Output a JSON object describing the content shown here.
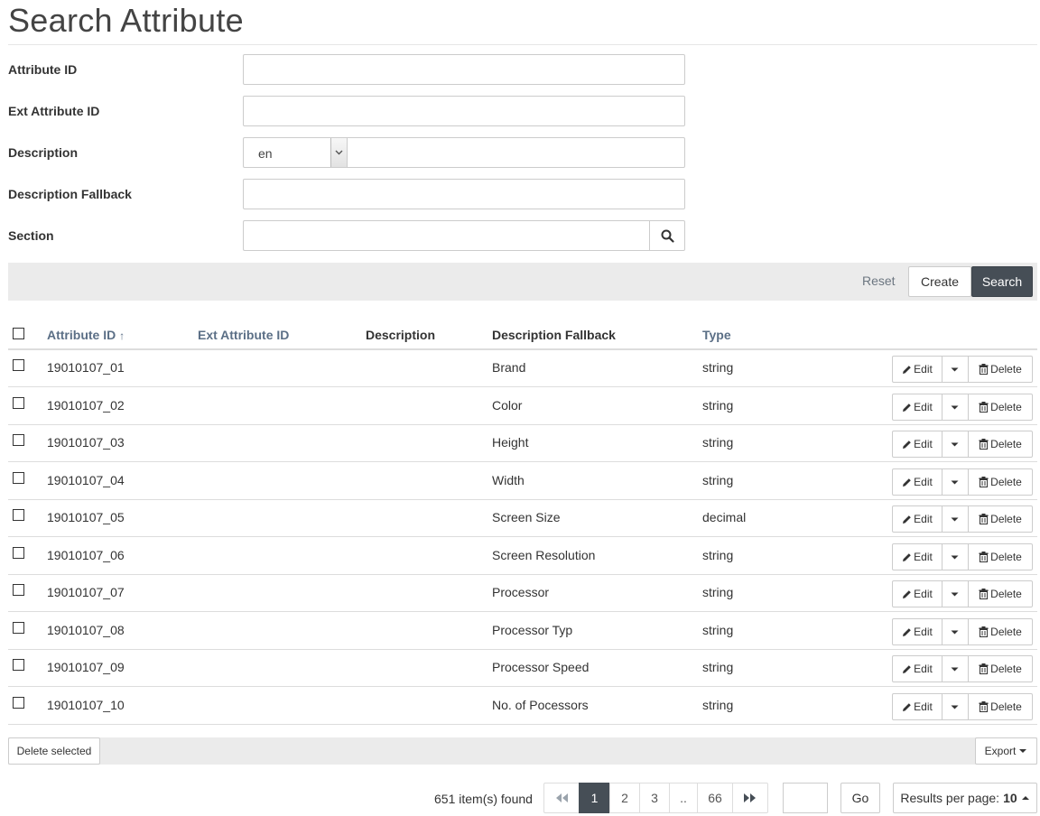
{
  "page": {
    "title": "Search Attribute"
  },
  "form": {
    "attribute_id": {
      "label": "Attribute ID",
      "value": ""
    },
    "ext_attribute_id": {
      "label": "Ext Attribute ID",
      "value": ""
    },
    "description": {
      "label": "Description",
      "language": "en",
      "value": ""
    },
    "description_fallback": {
      "label": "Description Fallback",
      "value": ""
    },
    "section": {
      "label": "Section",
      "value": ""
    }
  },
  "actions": {
    "reset": "Reset",
    "create": "Create",
    "search": "Search"
  },
  "table": {
    "columns": {
      "attribute_id": "Attribute ID",
      "ext_attribute_id": "Ext Attribute ID",
      "description": "Description",
      "description_fallback": "Description Fallback",
      "type": "Type"
    },
    "sort_indicator": "↑",
    "rows": [
      {
        "id": "19010107_01",
        "ext_id": "",
        "description": "",
        "fallback": "Brand",
        "type": "string"
      },
      {
        "id": "19010107_02",
        "ext_id": "",
        "description": "",
        "fallback": "Color",
        "type": "string"
      },
      {
        "id": "19010107_03",
        "ext_id": "",
        "description": "",
        "fallback": "Height",
        "type": "string"
      },
      {
        "id": "19010107_04",
        "ext_id": "",
        "description": "",
        "fallback": "Width",
        "type": "string"
      },
      {
        "id": "19010107_05",
        "ext_id": "",
        "description": "",
        "fallback": "Screen Size",
        "type": "decimal"
      },
      {
        "id": "19010107_06",
        "ext_id": "",
        "description": "",
        "fallback": "Screen Resolution",
        "type": "string"
      },
      {
        "id": "19010107_07",
        "ext_id": "",
        "description": "",
        "fallback": "Processor",
        "type": "string"
      },
      {
        "id": "19010107_08",
        "ext_id": "",
        "description": "",
        "fallback": "Processor Typ",
        "type": "string"
      },
      {
        "id": "19010107_09",
        "ext_id": "",
        "description": "",
        "fallback": "Processor Speed",
        "type": "string"
      },
      {
        "id": "19010107_10",
        "ext_id": "",
        "description": "",
        "fallback": "No. of Pocessors",
        "type": "string"
      }
    ],
    "row_actions": {
      "edit": "Edit",
      "delete": "Delete"
    }
  },
  "footer": {
    "delete_selected": "Delete selected",
    "export": "Export"
  },
  "pagination": {
    "items_found": "651 item(s) found",
    "pages": [
      "1",
      "2",
      "3",
      "..",
      "66"
    ],
    "current_page": "1",
    "go": "Go",
    "results_per_page_label": "Results per page:",
    "results_per_page_value": "10"
  },
  "colors": {
    "primary_dark": "#464e56",
    "link": "#5b6f86",
    "bar_bg": "#ebebeb"
  }
}
